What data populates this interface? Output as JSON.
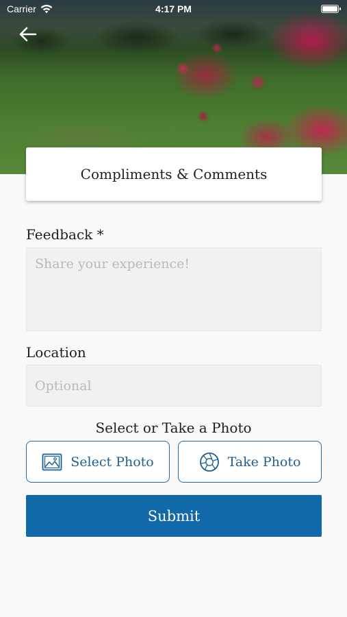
{
  "status_bar": {
    "carrier": "Carrier",
    "time": "4:17 PM",
    "wifi_icon": "wifi-icon",
    "battery_icon": "battery-icon"
  },
  "header": {
    "back_icon": "arrow-left-icon",
    "title": "Compliments & Comments"
  },
  "form": {
    "feedback": {
      "label": "Feedback *",
      "value": "",
      "placeholder": "Share your experience!"
    },
    "location": {
      "label": "Location",
      "value": "",
      "placeholder": "Optional"
    },
    "photo": {
      "heading": "Select or Take a Photo",
      "select_label": "Select Photo",
      "select_icon": "image-icon",
      "take_label": "Take Photo",
      "take_icon": "camera-aperture-icon"
    },
    "submit_label": "Submit"
  },
  "colors": {
    "accent": "#1169a9",
    "button_outline": "#1e6aa6",
    "field_background": "#f1f1f1",
    "page_background": "#f9f9f9"
  }
}
